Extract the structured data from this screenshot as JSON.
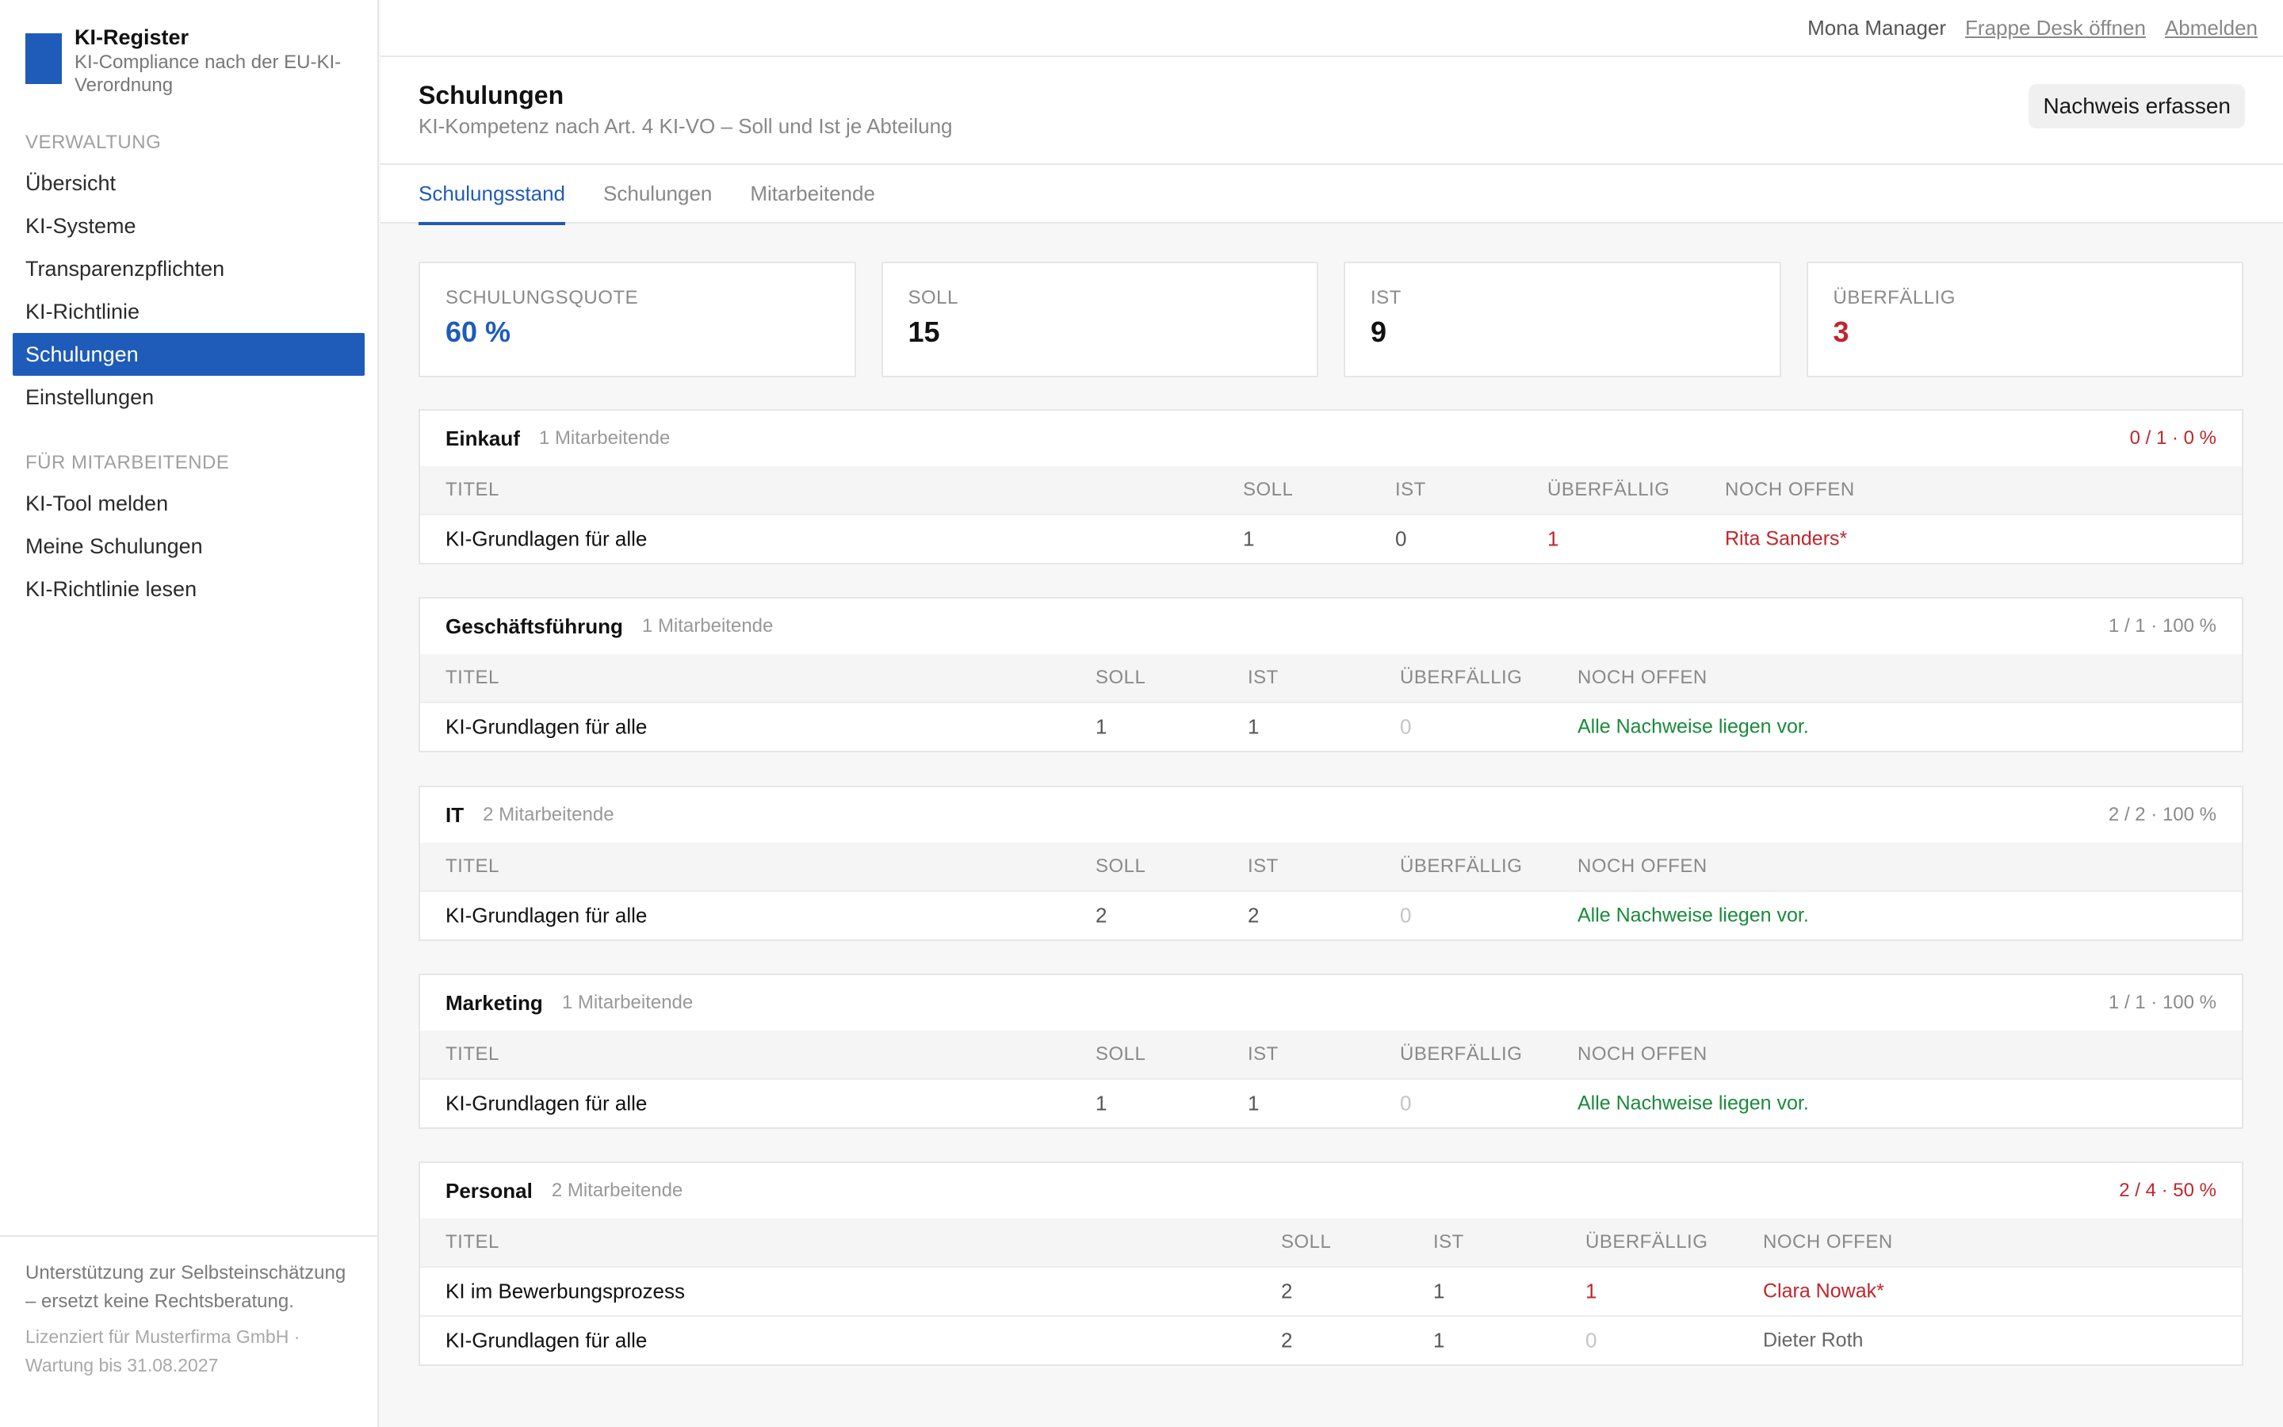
{
  "brand": {
    "name": "KI-Register",
    "subtitle": "KI-Compliance nach der EU-KI-Verordnung"
  },
  "nav": {
    "sections": [
      {
        "heading": "VERWALTUNG",
        "items": [
          "Übersicht",
          "KI-Systeme",
          "Transparenzpflichten",
          "KI-Richtlinie",
          "Schulungen",
          "Einstellungen"
        ]
      },
      {
        "heading": "FÜR MITARBEITENDE",
        "items": [
          "KI-Tool melden",
          "Meine Schulungen",
          "KI-Richtlinie lesen"
        ]
      }
    ],
    "active": "Schulungen"
  },
  "footer": {
    "note": "Unterstützung zur Selbsteinschätzung – ersetzt keine Rechtsberatung.",
    "license": "Lizenziert für Musterfirma GmbH · Wartung bis 31.08.2027"
  },
  "topbar": {
    "user": "Mona Manager",
    "desk_link": "Frappe Desk öffnen",
    "logout": "Abmelden"
  },
  "page": {
    "title": "Schulungen",
    "subtitle": "KI-Kompetenz nach Art. 4 KI-VO – Soll und Ist je Abteilung",
    "action": "Nachweis erfassen"
  },
  "tabs": [
    "Schulungsstand",
    "Schulungen",
    "Mitarbeitende"
  ],
  "active_tab": "Schulungsstand",
  "stats": [
    {
      "label": "SCHULUNGSQUOTE",
      "value": "60 %",
      "color": "#1f5bb8"
    },
    {
      "label": "SOLL",
      "value": "15",
      "color": "#111111"
    },
    {
      "label": "IST",
      "value": "9",
      "color": "#111111"
    },
    {
      "label": "ÜBERFÄLLIG",
      "value": "3",
      "color": "#c0262d"
    }
  ],
  "columns": {
    "title": "TITEL",
    "soll": "SOLL",
    "ist": "IST",
    "overdue": "ÜBERFÄLLIG",
    "open": "NOCH OFFEN"
  },
  "departments": [
    {
      "name": "Einkauf",
      "count": "1 Mitarbeitende",
      "summary": "0 / 1 · 0 %",
      "status": "bad",
      "rows": [
        {
          "title": "KI-Grundlagen für alle",
          "soll": "1",
          "ist": "0",
          "overdue": "1",
          "open": "Rita Sanders*",
          "open_state": "overdue"
        }
      ]
    },
    {
      "name": "Geschäftsführung",
      "count": "1 Mitarbeitende",
      "summary": "1 / 1 · 100 %",
      "status": "ok",
      "rows": [
        {
          "title": "KI-Grundlagen für alle",
          "soll": "1",
          "ist": "1",
          "overdue": "0",
          "open": "Alle Nachweise liegen vor.",
          "open_state": "done"
        }
      ]
    },
    {
      "name": "IT",
      "count": "2 Mitarbeitende",
      "summary": "2 / 2 · 100 %",
      "status": "ok",
      "rows": [
        {
          "title": "KI-Grundlagen für alle",
          "soll": "2",
          "ist": "2",
          "overdue": "0",
          "open": "Alle Nachweise liegen vor.",
          "open_state": "done"
        }
      ]
    },
    {
      "name": "Marketing",
      "count": "1 Mitarbeitende",
      "summary": "1 / 1 · 100 %",
      "status": "ok",
      "rows": [
        {
          "title": "KI-Grundlagen für alle",
          "soll": "1",
          "ist": "1",
          "overdue": "0",
          "open": "Alle Nachweise liegen vor.",
          "open_state": "done"
        }
      ]
    },
    {
      "name": "Personal",
      "count": "2 Mitarbeitende",
      "summary": "2 / 4 · 50 %",
      "status": "bad",
      "rows": [
        {
          "title": "KI im Bewerbungsprozess",
          "soll": "2",
          "ist": "1",
          "overdue": "1",
          "open": "Clara Nowak*",
          "open_state": "overdue"
        },
        {
          "title": "KI-Grundlagen für alle",
          "soll": "2",
          "ist": "1",
          "overdue": "0",
          "open": "Dieter Roth",
          "open_state": "pending"
        }
      ]
    }
  ]
}
